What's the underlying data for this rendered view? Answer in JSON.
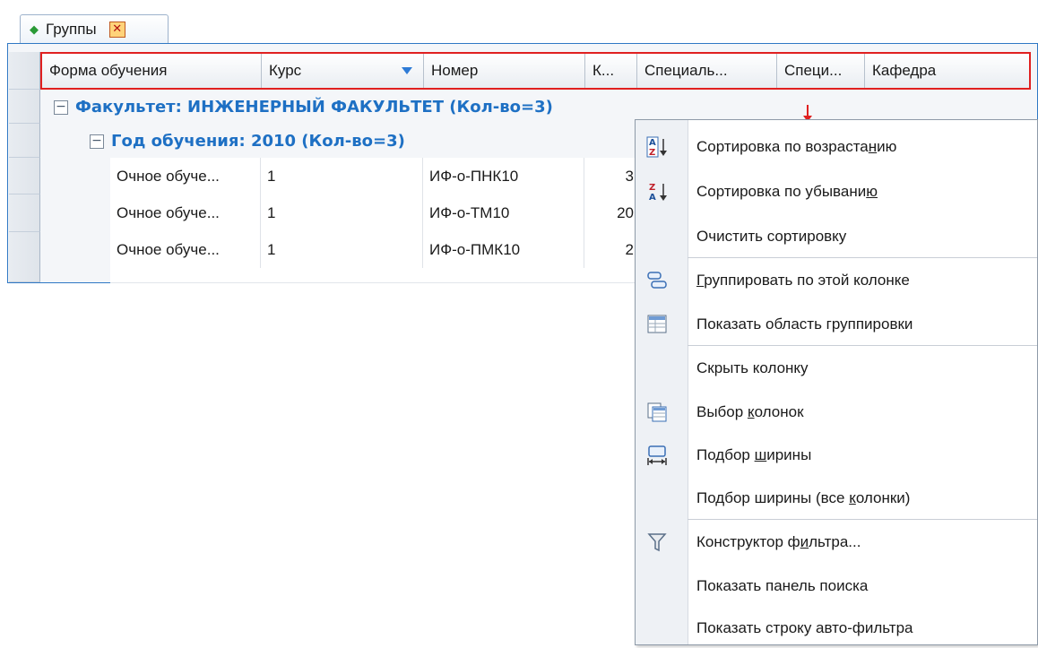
{
  "tab": {
    "title": "Группы",
    "close_glyph": "✕"
  },
  "grid": {
    "columns": [
      {
        "label": "Форма обучения"
      },
      {
        "label": "Курс"
      },
      {
        "label": "Номер"
      },
      {
        "label": "К..."
      },
      {
        "label": "Специаль..."
      },
      {
        "label": "Специ..."
      },
      {
        "label": "Кафедра"
      }
    ],
    "group1": "Факультет: ИНЖЕНЕРНЫЙ ФАКУЛЬТЕТ (Кол-во=3)",
    "group2": "Год обучения: 2010 (Кол-во=3)",
    "rows": [
      {
        "form": "Очное обуче...",
        "course": "1",
        "number": "ИФ-о-ПНК10",
        "k": "3"
      },
      {
        "form": "Очное обуче...",
        "course": "1",
        "number": "ИФ-о-ТМ10",
        "k": "20"
      },
      {
        "form": "Очное обуче...",
        "course": "1",
        "number": "ИФ-о-ПМК10",
        "k": "2"
      }
    ]
  },
  "menu": {
    "items": [
      {
        "pre": "Сортировка по возраста",
        "u": "н",
        "post": "ию",
        "icon": "sort-ascending-icon"
      },
      {
        "pre": "Сортировка по убывани",
        "u": "ю",
        "post": "",
        "icon": "sort-descending-icon"
      },
      {
        "pre": "Очистить сортировку",
        "u": "",
        "post": "",
        "icon": ""
      },
      {
        "pre": "",
        "u": "Г",
        "post": "руппировать по этой колонке",
        "icon": "group-by-column-icon"
      },
      {
        "pre": "Показать область группировки",
        "u": "",
        "post": "",
        "icon": "group-panel-icon"
      },
      {
        "pre": "Скрыть колонку",
        "u": "",
        "post": "",
        "icon": ""
      },
      {
        "pre": "Выбор ",
        "u": "к",
        "post": "олонок",
        "icon": "column-chooser-icon"
      },
      {
        "pre": "Подбор ",
        "u": "ш",
        "post": "ирины",
        "icon": "best-fit-icon"
      },
      {
        "pre": "Подбор ширины (все ",
        "u": "к",
        "post": "олонки)",
        "icon": ""
      },
      {
        "pre": "Конструктор ф",
        "u": "и",
        "post": "льтра...",
        "icon": "filter-icon"
      },
      {
        "pre": "Показать панель поиска",
        "u": "",
        "post": "",
        "icon": ""
      },
      {
        "pre": "Показать строку авто-фильтра",
        "u": "",
        "post": "",
        "icon": ""
      }
    ]
  }
}
